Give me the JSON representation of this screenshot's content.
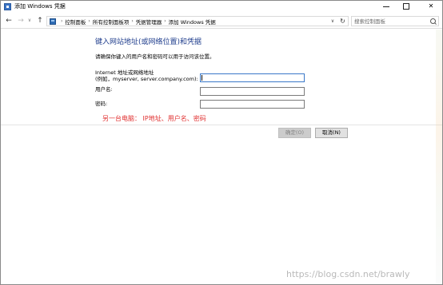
{
  "window": {
    "title": "添加 Windows 凭据",
    "minimize_icon": "minimize-icon",
    "maximize_icon": "maximize-icon",
    "close_glyph": "✕"
  },
  "nav": {
    "back": "←",
    "forward": "→",
    "recent": "∨",
    "up": "↑",
    "breadcrumbs": [
      "控制面板",
      "所有控制面板项",
      "凭据管理器",
      "添加 Windows 凭据"
    ],
    "separator": "›",
    "dropdown": "∨",
    "refresh": "↻",
    "search_placeholder": "搜索控制面板"
  },
  "form": {
    "heading": "键入网站地址(或网络位置)和凭据",
    "subheading": "请确保你键入的用户名和密码可以用于访问该位置。",
    "address_label_line1": "Internet 地址或网络地址",
    "address_label_line2": "(例如，myserver, server.company.com):",
    "address_value": "",
    "username_label": "用户名:",
    "username_value": "",
    "password_label": "密码:",
    "password_value": "",
    "annotation": "另一台电脑：  IP地址、用户名、密码",
    "ok_label": "确定(O)",
    "cancel_label": "取消(N)"
  },
  "watermark": "https://blog.csdn.net/brawly",
  "colors": {
    "heading": "#1e3c8c",
    "annotation": "#e03030",
    "focus_border": "#3a78c8"
  }
}
